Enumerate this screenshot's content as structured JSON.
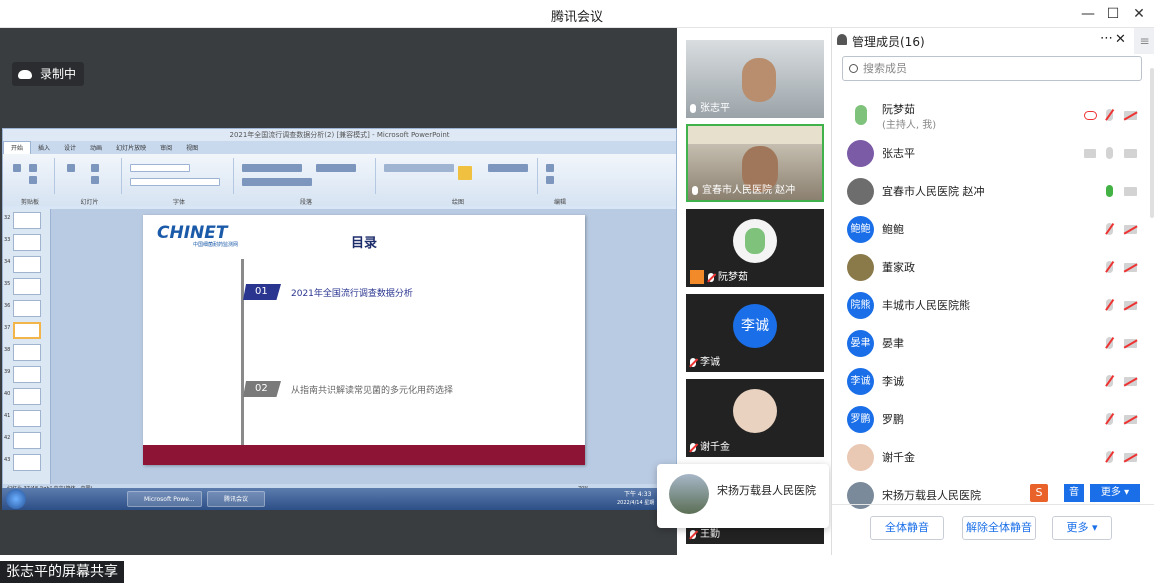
{
  "window": {
    "title": "腾讯会议",
    "min": "—",
    "max": "☐",
    "close": "✕"
  },
  "share": {
    "recording": "录制中",
    "sharing_label": "张志平的屏幕共享",
    "ppt": {
      "title": "2021年全国流行调查数据分析(2) [兼容模式] - Microsoft PowerPoint",
      "tabs": [
        "开始",
        "插入",
        "设计",
        "动画",
        "幻灯片放映",
        "审阅",
        "视图"
      ],
      "group_labels": [
        "剪贴板",
        "幻灯片",
        "字体",
        "段落",
        "绘图",
        "编辑"
      ],
      "thumb_numbers": [
        "32",
        "33",
        "34",
        "35",
        "36",
        "37",
        "38",
        "39",
        "40",
        "41",
        "42",
        "43"
      ],
      "slide": {
        "logo": "CHINET",
        "logo_sub": "中国细菌耐药监测网",
        "title": "目录",
        "items": [
          {
            "num": "01",
            "text": "2021年全国流行调查数据分析"
          },
          {
            "num": "02",
            "text": "从指南共识解读常见菌的多元化用药选择"
          }
        ]
      },
      "status": "幻灯片 37/48    \"igh\"    中文(简体，中国)",
      "zoom": "70%"
    },
    "taskbar": {
      "items": [
        "Microsoft Powe...",
        "腾讯会议"
      ],
      "clock": "下午 4:33",
      "date": "2022/4/14 星期"
    }
  },
  "tiles": [
    {
      "name": "张志平",
      "muted": false
    },
    {
      "name": "宜春市人民医院 赵冲",
      "muted": false
    },
    {
      "name": "阮梦茹",
      "muted": true
    },
    {
      "name": "李诚",
      "muted": true,
      "avatar_text": "李诚"
    },
    {
      "name": "谢千金",
      "muted": true
    },
    {
      "name": "王勤",
      "muted": true
    }
  ],
  "remote_popup": {
    "name": "宋扬万载县人民医院"
  },
  "panel": {
    "title": "管理成员(16)",
    "search_placeholder": "搜索成员",
    "members": [
      {
        "name": "阮梦茹",
        "sub": "(主持人, 我)",
        "avatar": "",
        "color": "#ffffff"
      },
      {
        "name": "张志平",
        "sub": "",
        "avatar": "",
        "color": "#7b5aa6"
      },
      {
        "name": "宜春市人民医院 赵冲",
        "sub": "",
        "avatar": "",
        "color": "#6d6d6d"
      },
      {
        "name": "鲍鲍",
        "sub": "",
        "avatar": "鲍鲍",
        "color": "#1a6fe8"
      },
      {
        "name": "董家政",
        "sub": "",
        "avatar": "",
        "color": "#8a7a4a"
      },
      {
        "name": "丰城市人民医院熊",
        "sub": "",
        "avatar": "院熊",
        "color": "#1a6fe8"
      },
      {
        "name": "晏聿",
        "sub": "",
        "avatar": "晏聿",
        "color": "#1a6fe8"
      },
      {
        "name": "李诚",
        "sub": "",
        "avatar": "李诚",
        "color": "#1a6fe8"
      },
      {
        "name": "罗鹏",
        "sub": "",
        "avatar": "罗鹏",
        "color": "#1a6fe8"
      },
      {
        "name": "谢千金",
        "sub": "",
        "avatar": "",
        "color": "#c99"
      },
      {
        "name": "宋扬万载县人民医院",
        "sub": "",
        "avatar": "",
        "color": "#7a8a9a"
      }
    ],
    "buttons": {
      "mute_all": "全体静音",
      "unmute_all": "解除全体静音",
      "more": "更多 ▾",
      "more_blue": "更多 ▾",
      "audio": "音"
    }
  }
}
